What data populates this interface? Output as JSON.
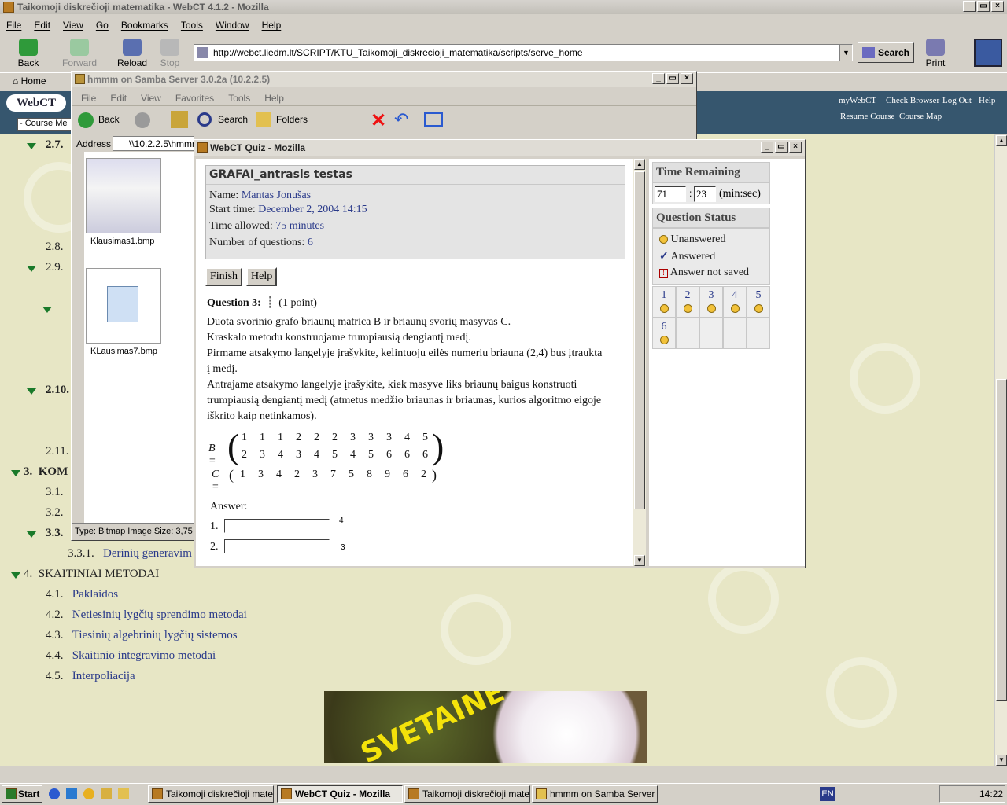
{
  "main_window": {
    "title": "Taikomoji diskrečioji matematika - WebCT 4.1.2 - Mozilla",
    "menu": [
      "File",
      "Edit",
      "View",
      "Go",
      "Bookmarks",
      "Tools",
      "Window",
      "Help"
    ],
    "toolbar": {
      "back": "Back",
      "forward": "Forward",
      "reload": "Reload",
      "stop": "Stop",
      "search": "Search",
      "print": "Print"
    },
    "url": "http://webct.liedm.lt/SCRIPT/KTU_Taikomoji_diskrecioji_matematika/scripts/serve_home",
    "bookmark_home": "Home"
  },
  "webct": {
    "logo": "WebCT",
    "links_top": [
      "myWebCT",
      "Check Browser",
      "Log Out",
      "Help"
    ],
    "links_bottom": [
      "Resume Course",
      "Course Map"
    ],
    "course_menu": "- Course Me"
  },
  "toc": {
    "item_27": "2.7.",
    "item_28": "2.8.",
    "item_29": "2.9.",
    "item_210": "2.10.",
    "item_211": "2.11.",
    "item_3": "3.",
    "item_3_label": "KOM",
    "item_31": "3.1.",
    "item_32": "3.2.",
    "item_33": "3.3.",
    "item_331": "3.3.1.",
    "item_331_label": "Derinių generavim",
    "item_4": "4.",
    "item_4_label": "SKAITINIAI METODAI",
    "sub4": [
      {
        "num": "4.1.",
        "label": "Paklaidos"
      },
      {
        "num": "4.2.",
        "label": "Netiesinių lygčių sprendimo metodai"
      },
      {
        "num": "4.3.",
        "label": "Tiesinių algebrinių lygčių sistemos"
      },
      {
        "num": "4.4.",
        "label": "Skaitinio integravimo metodai"
      },
      {
        "num": "4.5.",
        "label": "Interpoliacija"
      }
    ]
  },
  "explorer": {
    "title": "hmmm on Samba Server 3.0.2a (10.2.2.5)",
    "menu": [
      "File",
      "Edit",
      "View",
      "Favorites",
      "Tools",
      "Help"
    ],
    "back": "Back",
    "search": "Search",
    "folders": "Folders",
    "address_label": "Address",
    "address": "\\\\10.2.2.5\\hmmm",
    "files": [
      "Klausimas1.bmp",
      "KLausimas7.bmp"
    ],
    "status": "Type: Bitmap Image Size: 3,75"
  },
  "quiz": {
    "window_title": "WebCT Quiz - Mozilla",
    "name_header": "GRAFAI_antrasis testas",
    "name_label": "Name:",
    "name_value": "Mantas Jonušas",
    "start_label": "Start time:",
    "start_value": "December 2, 2004 14:15",
    "allowed_label": "Time allowed:",
    "allowed_value": "75 minutes",
    "num_label": "Number of questions:",
    "num_value": "6",
    "finish": "Finish",
    "help": "Help",
    "question_label": "Question 3:",
    "points": "(1 point)",
    "text": [
      "Duota svorinio grafo briaunų matrica B ir briaunų svorių masyvas C.",
      "Kraskalo metodu konstruojame trumpiausią dengiantį medį.",
      "Pirmame atsakymo langelyje įrašykite, kelintuoju eilės numeriu briauna (2,4) bus įtraukta",
      "į medį.",
      "Antrajame atsakymo langelyje įrašykite, kiek masyve liks briaunų baigus konstruoti",
      "trumpiausią dengiantį medį (atmetus medžio briaunas ir briaunas, kurios algoritmo eigoje",
      "iškrito kaip netinkamos)."
    ],
    "matrix_B_label": "B =",
    "matrix_B_row1": [
      "1",
      "1",
      "1",
      "2",
      "2",
      "2",
      "3",
      "3",
      "3",
      "4",
      "5"
    ],
    "matrix_B_row2": [
      "2",
      "3",
      "4",
      "3",
      "4",
      "5",
      "4",
      "5",
      "6",
      "6",
      "6"
    ],
    "matrix_C_label": "C =",
    "matrix_C_row": [
      "1",
      "3",
      "4",
      "2",
      "3",
      "7",
      "5",
      "8",
      "9",
      "6",
      "2"
    ],
    "answer_label": "Answer:",
    "answers": [
      {
        "num": "1.",
        "value": "",
        "mark": "4"
      },
      {
        "num": "2.",
        "value": "",
        "mark": "3"
      }
    ],
    "time_remaining": "Time Remaining",
    "min": "71",
    "sec": "23",
    "minsec": "(min:sec)",
    "question_status": "Question Status",
    "legend": {
      "unanswered": "Unanswered",
      "answered": "Answered",
      "not_saved": "Answer not saved"
    },
    "questions": [
      "1",
      "2",
      "3",
      "4",
      "5",
      "6"
    ]
  },
  "taskbar": {
    "start": "Start",
    "tasks": [
      "Taikomoji diskrečioji mate...",
      "WebCT Quiz - Mozilla",
      "Taikomoji diskrečioji mate...",
      "hmmm on Samba Server ..."
    ],
    "lang": "EN",
    "clock": "14:22"
  },
  "colors": {
    "accent_blue": "#2a3a8a",
    "webct_header": "#36566e",
    "tree_green": "#1a7a2a",
    "page_bg": "#e7e6c5"
  }
}
